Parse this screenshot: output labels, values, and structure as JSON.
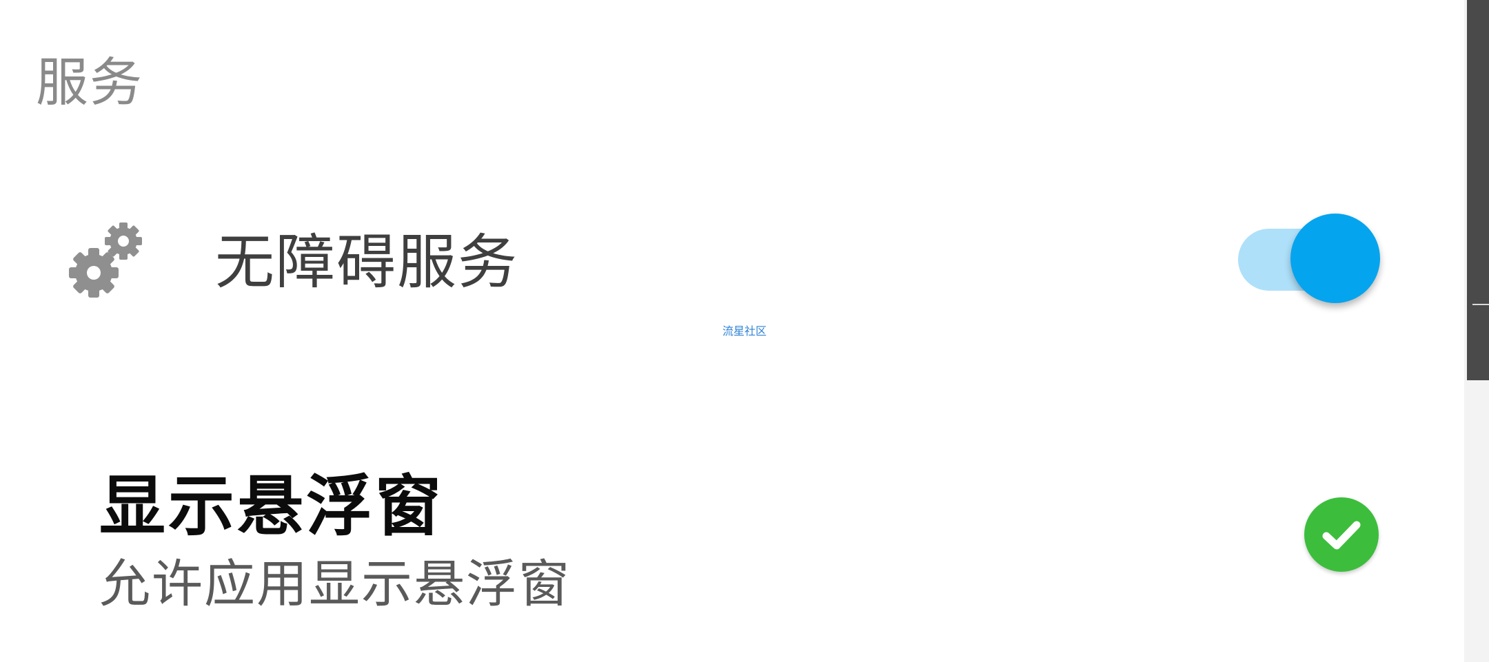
{
  "section": {
    "title": "服务"
  },
  "accessibility_row": {
    "icon": "gears-icon",
    "label": "无障碍服务",
    "toggle_on": true
  },
  "watermark": "流星社区",
  "floating_window_row": {
    "title": "显示悬浮窗",
    "subtitle": "允许应用显示悬浮窗",
    "status_icon": "check-circle-icon",
    "granted": true
  },
  "colors": {
    "accent_blue": "#05a4ef",
    "track_blue": "#aee0f9",
    "success_green": "#3cbe3c",
    "header_gray": "#8a8a8a"
  }
}
